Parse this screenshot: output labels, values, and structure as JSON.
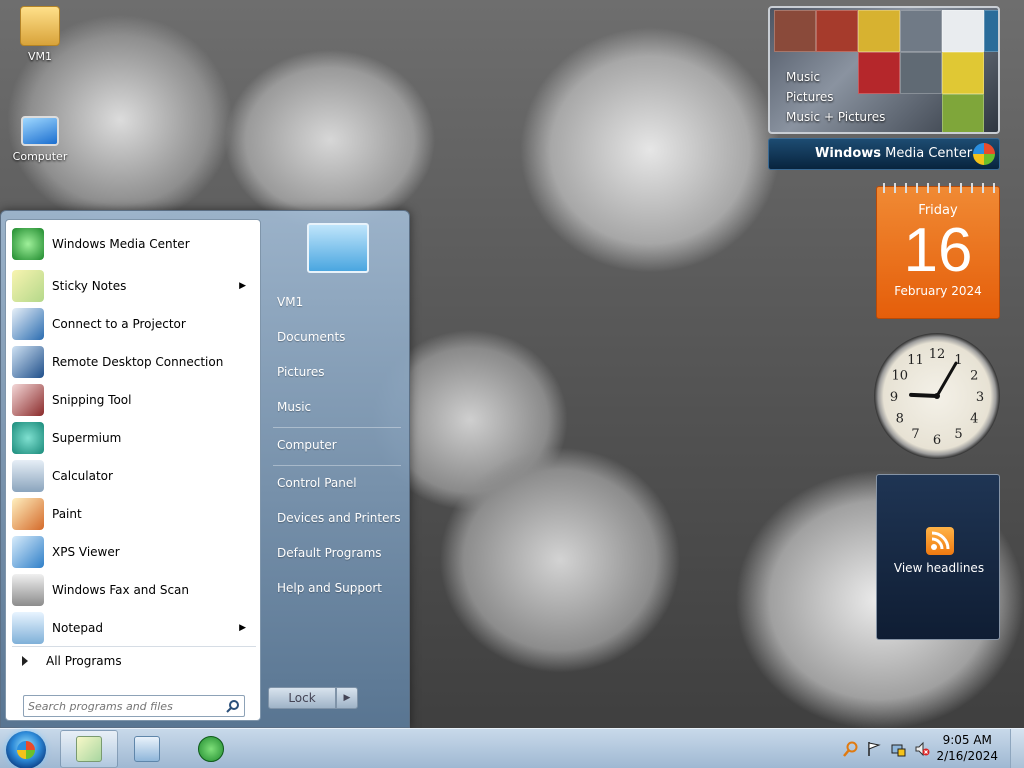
{
  "desktop": {
    "icons": [
      {
        "label": "VM1",
        "icon": "user-folder-icon"
      },
      {
        "label": "Computer",
        "icon": "computer-icon"
      }
    ]
  },
  "start_menu": {
    "pinned": [
      {
        "label": "Windows Media Center",
        "icon": "windows-media-center-icon",
        "has_submenu": false
      },
      {
        "label": "Sticky Notes",
        "icon": "sticky-notes-icon",
        "has_submenu": true
      },
      {
        "label": "Connect to a Projector",
        "icon": "projector-icon",
        "has_submenu": false
      },
      {
        "label": "Remote Desktop Connection",
        "icon": "remote-desktop-icon",
        "has_submenu": false
      },
      {
        "label": "Snipping Tool",
        "icon": "scissors-icon",
        "has_submenu": false
      },
      {
        "label": "Supermium",
        "icon": "supermium-icon",
        "has_submenu": false
      },
      {
        "label": "Calculator",
        "icon": "calculator-icon",
        "has_submenu": false
      },
      {
        "label": "Paint",
        "icon": "paint-palette-icon",
        "has_submenu": false
      },
      {
        "label": "XPS Viewer",
        "icon": "xps-viewer-icon",
        "has_submenu": false
      },
      {
        "label": "Windows Fax and Scan",
        "icon": "fax-icon",
        "has_submenu": false
      },
      {
        "label": "Notepad",
        "icon": "notepad-icon",
        "has_submenu": true
      }
    ],
    "all_programs": "All Programs",
    "search_placeholder": "Search programs and files",
    "right_links": [
      {
        "label": "VM1"
      },
      {
        "label": "Documents"
      },
      {
        "label": "Pictures"
      },
      {
        "label": "Music"
      },
      {
        "label": "Computer"
      },
      {
        "label": "Control Panel"
      },
      {
        "label": "Devices and Printers"
      },
      {
        "label": "Default Programs"
      },
      {
        "label": "Help and Support"
      }
    ],
    "lock_label": "Lock",
    "lock_arrow": "▶"
  },
  "gadgets": {
    "media_center": {
      "items": [
        "Music",
        "Pictures",
        "Music + Pictures"
      ],
      "title_bold": "Windows",
      "title_rest": " Media Center"
    },
    "calendar": {
      "weekday": "Friday",
      "day": "16",
      "month_year": "February 2024"
    },
    "clock": {
      "numbers": [
        "12",
        "1",
        "2",
        "3",
        "4",
        "5",
        "6",
        "7",
        "8",
        "9",
        "10",
        "11"
      ],
      "time_hours": 9,
      "time_minutes": 5
    },
    "feed": {
      "label": "View headlines"
    }
  },
  "taskbar": {
    "pinned": [
      {
        "icon": "sticky-notes-icon",
        "active": true
      },
      {
        "icon": "document-viewer-icon",
        "active": false
      },
      {
        "icon": "windows-media-center-icon",
        "active": false
      }
    ],
    "tray": {
      "icons": [
        "search-magnifier-icon",
        "action-center-flag-icon",
        "network-icon",
        "volume-muted-icon"
      ],
      "time": "9:05 AM",
      "date": "2/16/2024"
    }
  },
  "colors": {
    "calendar_orange": "#e8650f",
    "taskbar": "#b3c9e0",
    "wmc_bar": "#0f3353"
  }
}
